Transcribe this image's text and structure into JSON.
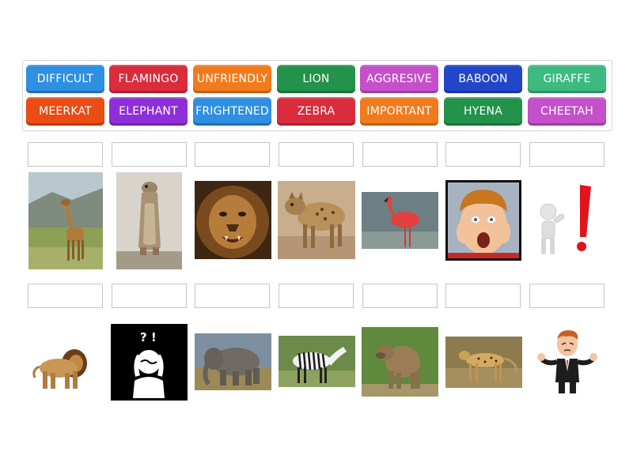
{
  "word_bank": {
    "tiles": [
      {
        "label": "DIFFICULT",
        "color": "#2f8fe0"
      },
      {
        "label": "FLAMINGO",
        "color": "#d92c3c"
      },
      {
        "label": "UNFRIENDLY",
        "color": "#f07b1d"
      },
      {
        "label": "LION",
        "color": "#23924a"
      },
      {
        "label": "AGGRESIVE",
        "color": "#c451c9"
      },
      {
        "label": "BABOON",
        "color": "#2146c9"
      },
      {
        "label": "GIRAFFE",
        "color": "#3dba7f"
      },
      {
        "label": "MEERKAT",
        "color": "#ea4c14"
      },
      {
        "label": "ELEPHANT",
        "color": "#8f2fd9"
      },
      {
        "label": "FRIGHTENED",
        "color": "#2f8fe0"
      },
      {
        "label": "ZEBRA",
        "color": "#d92c3c"
      },
      {
        "label": "IMPORTANT",
        "color": "#f07b1d"
      },
      {
        "label": "HYENA",
        "color": "#23924a"
      },
      {
        "label": "CHEETAH",
        "color": "#c451c9"
      }
    ]
  },
  "images": {
    "row1": [
      "giraffe-image",
      "meerkat-image",
      "lion-face-image",
      "hyena-image",
      "flamingo-image",
      "frightened-boy-image",
      "important-figure-image"
    ],
    "row2": [
      "lion-image",
      "difficult-icon-image",
      "elephant-image",
      "zebra-image",
      "baboon-image",
      "cheetah-image",
      "unfriendly-man-image"
    ]
  },
  "difficult_icon_text": "? !"
}
